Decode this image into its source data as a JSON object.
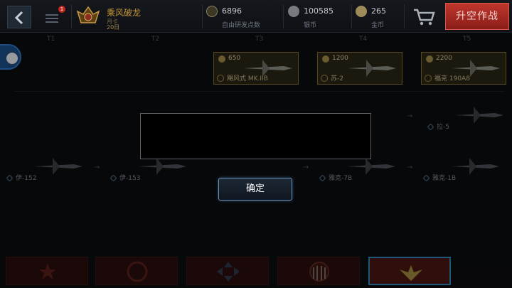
{
  "player": {
    "name": "乘风破龙",
    "subtitle": "月卡",
    "days": "20日",
    "badge_count": "1"
  },
  "resources": [
    {
      "value": "6896",
      "label": "自由研发点数",
      "icon": "research-star-icon",
      "color": "#8a8060"
    },
    {
      "value": "100585",
      "label": "银币",
      "icon": "silver-coin-icon",
      "color": "#8e9296"
    },
    {
      "value": "265",
      "label": "金币",
      "icon": "gold-coin-icon",
      "color": "#9f8a5a"
    }
  ],
  "actions": {
    "sortie": "升空作战",
    "confirm": "确定"
  },
  "tiers": [
    "T1",
    "T2",
    "T3",
    "T4",
    "T5"
  ],
  "locked_planes": [
    {
      "cost": "650",
      "name": "飓风式 MK.IIB"
    },
    {
      "cost": "1200",
      "name": "苏-2"
    },
    {
      "cost": "2200",
      "name": "福克 190A8"
    }
  ],
  "planes": [
    {
      "name": "伊-152"
    },
    {
      "name": "伊-153"
    },
    {
      "name": "雅克-7B"
    },
    {
      "name": "雅克-1B"
    },
    {
      "name": "拉-5"
    }
  ],
  "colors": {
    "accent_red": "#b8322a",
    "accent_gold": "#c79a3a",
    "active_border": "#2f86b8"
  }
}
